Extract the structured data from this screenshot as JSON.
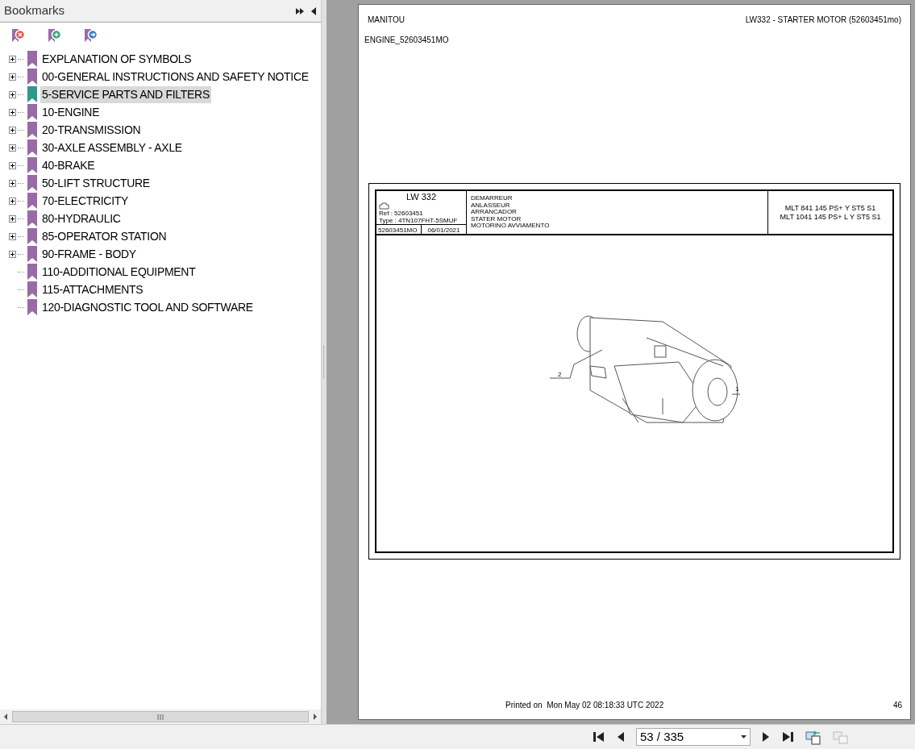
{
  "bookmarks_panel": {
    "title": "Bookmarks",
    "items": [
      {
        "label": "EXPLANATION OF SYMBOLS",
        "expandable": true,
        "selected": false
      },
      {
        "label": "00-GENERAL INSTRUCTIONS AND SAFETY NOTICE",
        "expandable": true,
        "selected": false
      },
      {
        "label": "5-SERVICE PARTS AND FILTERS",
        "expandable": true,
        "selected": true
      },
      {
        "label": "10-ENGINE",
        "expandable": true,
        "selected": false
      },
      {
        "label": "20-TRANSMISSION",
        "expandable": true,
        "selected": false
      },
      {
        "label": "30-AXLE ASSEMBLY - AXLE",
        "expandable": true,
        "selected": false
      },
      {
        "label": "40-BRAKE",
        "expandable": true,
        "selected": false
      },
      {
        "label": "50-LIFT STRUCTURE",
        "expandable": true,
        "selected": false
      },
      {
        "label": "70-ELECTRICITY",
        "expandable": true,
        "selected": false
      },
      {
        "label": "80-HYDRAULIC",
        "expandable": true,
        "selected": false
      },
      {
        "label": "85-OPERATOR STATION",
        "expandable": true,
        "selected": false
      },
      {
        "label": "90-FRAME - BODY",
        "expandable": true,
        "selected": false
      },
      {
        "label": "110-ADDITIONAL EQUIPMENT",
        "expandable": false,
        "selected": false
      },
      {
        "label": "115-ATTACHMENTS",
        "expandable": false,
        "selected": false
      },
      {
        "label": "120-DIAGNOSTIC TOOL AND SOFTWARE",
        "expandable": false,
        "selected": false
      }
    ]
  },
  "page": {
    "brand": "MANITOU",
    "title": "LW332 - STARTER MOTOR (52603451mo)",
    "section": "ENGINE_52603451MO",
    "sheet": {
      "code": "LW 332",
      "ref": "Ref : 52603451",
      "type": "Type : 4TN107FHT-5SMUF",
      "part_number": "52603451MO",
      "date": "06/01/2021",
      "names": [
        "DEMARREUR",
        "ANLASSEUR",
        "ARRANCADOR",
        "STATER MOTOR",
        "MOTORINO AVVIAMENTO"
      ],
      "models": [
        "MLT 841 145 PS+ Y ST5 S1",
        "MLT 1041 145 PS+ L Y ST5 S1"
      ],
      "callouts": [
        "1",
        "2"
      ]
    },
    "printed_on": "Printed on  Mon May 02 08:18:33 UTC 2022",
    "page_number": "46"
  },
  "navigation": {
    "page_field": "53 / 335"
  }
}
